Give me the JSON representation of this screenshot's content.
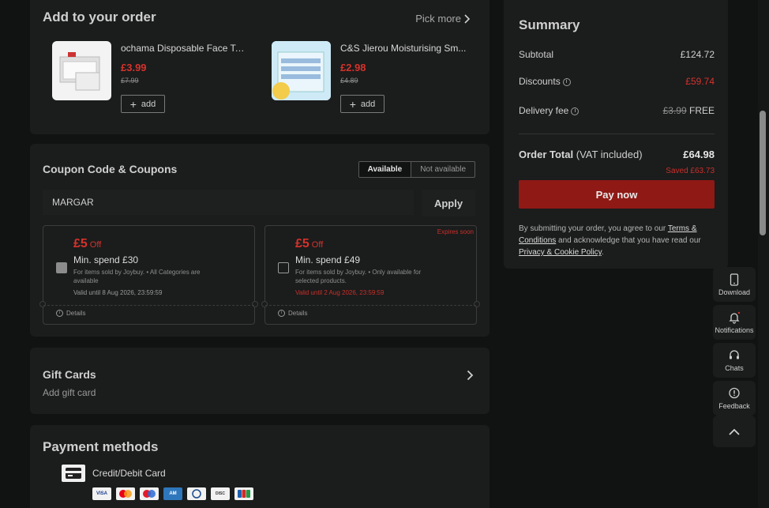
{
  "add_order": {
    "title": "Add to your order",
    "pick_more": "Pick more",
    "products": [
      {
        "name": "ochama Disposable Face To...",
        "price": "£3.99",
        "old_price": "£7.99",
        "add_label": "add"
      },
      {
        "name": "C&S Jierou Moisturising Sm...",
        "price": "£2.98",
        "old_price": "£4.89",
        "add_label": "add"
      }
    ]
  },
  "coupon": {
    "title": "Coupon Code & Coupons",
    "tab_available": "Available",
    "tab_unavailable": "Not available",
    "code_value": "MARGAR",
    "apply_label": "Apply",
    "items": [
      {
        "amount": "£5",
        "off": "Off",
        "condition": "Min. spend £30",
        "desc": "For items sold by Joybuy. • All Categories are available",
        "valid": "Valid until 8 Aug 2026, 23:59:59",
        "expire": "",
        "details": "Details"
      },
      {
        "amount": "£5",
        "off": "Off",
        "condition": "Min. spend £49",
        "desc": "For items sold by Joybuy. • Only available for selected products.",
        "valid": "Valid until 2 Aug 2026, 23:59:59",
        "expire": "Expires soon",
        "details": "Details"
      }
    ]
  },
  "gift": {
    "title": "Gift Cards",
    "subtitle": "Add gift card"
  },
  "payment": {
    "title": "Payment methods",
    "method_label": "Credit/Debit Card",
    "brands": [
      "VISA",
      "MC",
      "Maestro",
      "AMEX",
      "Diners",
      "DISCOVER",
      "JCB"
    ]
  },
  "summary": {
    "title": "Summary",
    "subtotal_label": "Subtotal",
    "subtotal_value": "£124.72",
    "discounts_label": "Discounts",
    "discounts_value": "£59.74",
    "delivery_label": "Delivery fee",
    "delivery_old": "£3.99",
    "delivery_value": "FREE",
    "total_label": "Order Total",
    "total_note": "(VAT included)",
    "total_value": "£64.98",
    "saved": "Saved £63.73",
    "pay_label": "Pay now",
    "legal_pre": "By submitting your order, you agree to our ",
    "legal_terms": "Terms & Conditions",
    "legal_mid": " and acknowledge that you have read our ",
    "legal_privacy": "Privacy & Cookie Policy",
    "legal_end": "."
  },
  "tools": {
    "download": "Download",
    "notifications": "Notifications",
    "chats": "Chats",
    "feedback": "Feedback"
  },
  "colors": {
    "accent": "#d6322c",
    "pay_button": "#8f1915",
    "background": "#111212",
    "card": "#1b1c1c"
  }
}
